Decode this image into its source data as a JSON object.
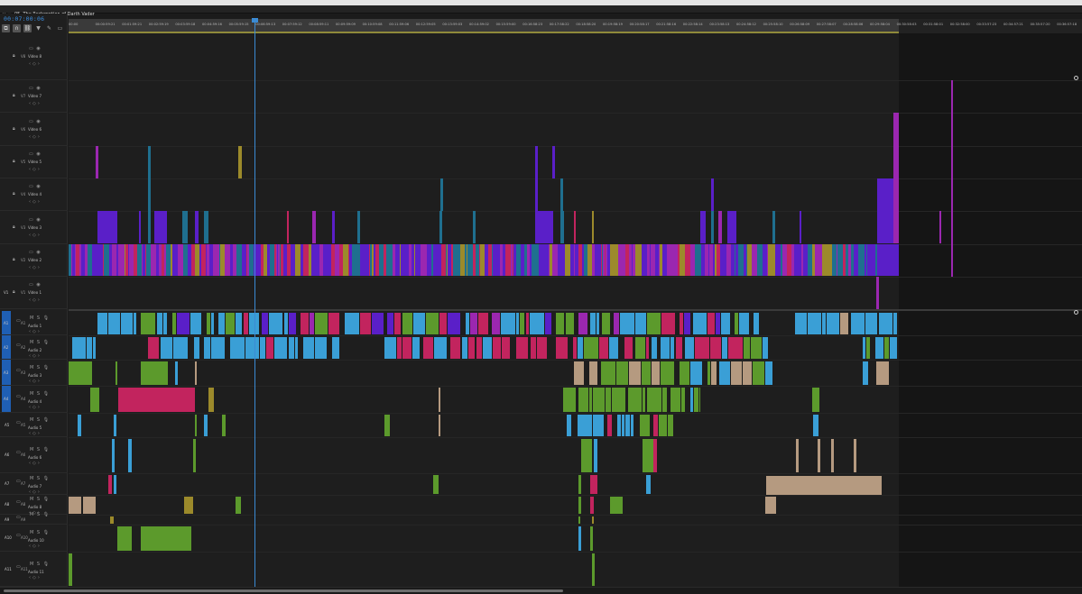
{
  "sequence": {
    "title": "05. The Redemption of Darth Vader",
    "timecode": "00:07:00:06"
  },
  "tools": {
    "snap_icon": "snap-icon",
    "linked_icon": "linked-selection-icon",
    "marker_icon": "add-marker-icon",
    "settings_icon": "wrench-icon",
    "captions_icon": "captions-icon"
  },
  "ruler": {
    "ticks": [
      "00:00",
      "00:00:59:21",
      "00:01:59:21",
      "00:02:59:19",
      "00:03:59:18",
      "00:04:59:16",
      "00:05:59:15",
      "00:06:59:13",
      "00:07:59:12",
      "00:08:59:11",
      "00:09:59:09",
      "00:10:59:08",
      "00:11:59:06",
      "00:12:59:05",
      "00:13:59:03",
      "00:14:59:02",
      "00:15:59:00",
      "00:16:58:23",
      "00:17:58:22",
      "00:18:58:20",
      "00:19:58:19",
      "00:20:58:17",
      "00:21:58:16",
      "00:22:58:14",
      "00:23:58:13",
      "00:24:58:12",
      "00:25:58:10",
      "00:26:58:09",
      "00:27:58:07",
      "00:28:58:06",
      "00:29:58:04",
      "00:30:58:03",
      "00:31:58:01",
      "00:32:58:00",
      "00:33:57:23",
      "00:34:57:21",
      "00:35:57:20",
      "00:36:57:18"
    ]
  },
  "video_tracks": [
    {
      "id": "V8",
      "name": "Video 8"
    },
    {
      "id": "V7",
      "name": "Video 7"
    },
    {
      "id": "V6",
      "name": "Video 6"
    },
    {
      "id": "V5",
      "name": "Video 5"
    },
    {
      "id": "V4",
      "name": "Video 4"
    },
    {
      "id": "V3",
      "name": "Video 3"
    },
    {
      "id": "V2",
      "name": "Video 2"
    },
    {
      "id": "V1",
      "name": "Video 1",
      "source": "V1"
    }
  ],
  "audio_tracks": [
    {
      "id": "A1",
      "name": "Audio 1",
      "source": "A1"
    },
    {
      "id": "A2",
      "name": "Audio 2",
      "source": "A2"
    },
    {
      "id": "A3",
      "name": "Audio 3",
      "source": "A3"
    },
    {
      "id": "A4",
      "name": "Audio 4",
      "source": "A4"
    },
    {
      "id": "A5",
      "name": "Audio 5"
    },
    {
      "id": "A6",
      "name": "Audio 6"
    },
    {
      "id": "A7",
      "name": "Audio 7"
    },
    {
      "id": "A8",
      "name": "Audio 8"
    },
    {
      "id": "A9",
      "name": ""
    },
    {
      "id": "A10",
      "name": "Audio 10"
    },
    {
      "id": "A11",
      "name": "Audio 11"
    }
  ],
  "track_controls": {
    "mute": "M",
    "solo": "S"
  },
  "colors": {
    "timecode": "#3c8ee0",
    "playhead": "#3b8bd4",
    "purple": "#5a1fc8",
    "magenta": "#9b27b0",
    "teal": "#1f6f8f",
    "pink": "#c2245e",
    "cyan": "#3a9fd6",
    "green": "#5c9a2c",
    "tan": "#b59a80",
    "olive": "#9c8a2b"
  }
}
